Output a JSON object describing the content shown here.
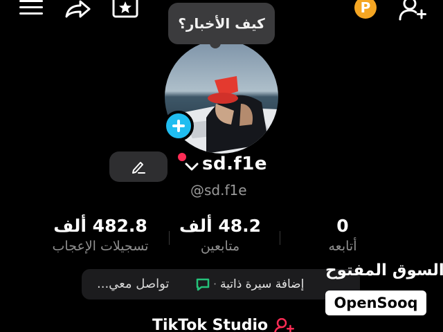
{
  "topbar": {
    "icons": [
      "menu-icon",
      "share-icon",
      "star-icon",
      "coin-icon",
      "add-user-icon"
    ],
    "coin_letter": "P",
    "coin_color": "#f5a623"
  },
  "note": {
    "text": "كيف الأخبار؟"
  },
  "profile": {
    "username": "sd.f1e",
    "handle": "@sd.f1e"
  },
  "stats": {
    "likes": {
      "value": "482.8 ألف",
      "label": "تسجيلات الإعجاب"
    },
    "followers": {
      "value": "48.2 ألف",
      "label": "متابعين"
    },
    "following": {
      "value": "0",
      "label": "أتابعه"
    }
  },
  "bio": {
    "contact": "تواصل معي...",
    "separator": "·",
    "add_bio": "إضافة سيرة ذاتية"
  },
  "studio": {
    "label": "TikTok Studio"
  },
  "watermark": {
    "arabic": "السوق المفتوح",
    "english": "OpenSooq"
  },
  "colors": {
    "accent_blue": "#20bdf0",
    "accent_red": "#fe2c55",
    "chat_green": "#25c27a"
  }
}
